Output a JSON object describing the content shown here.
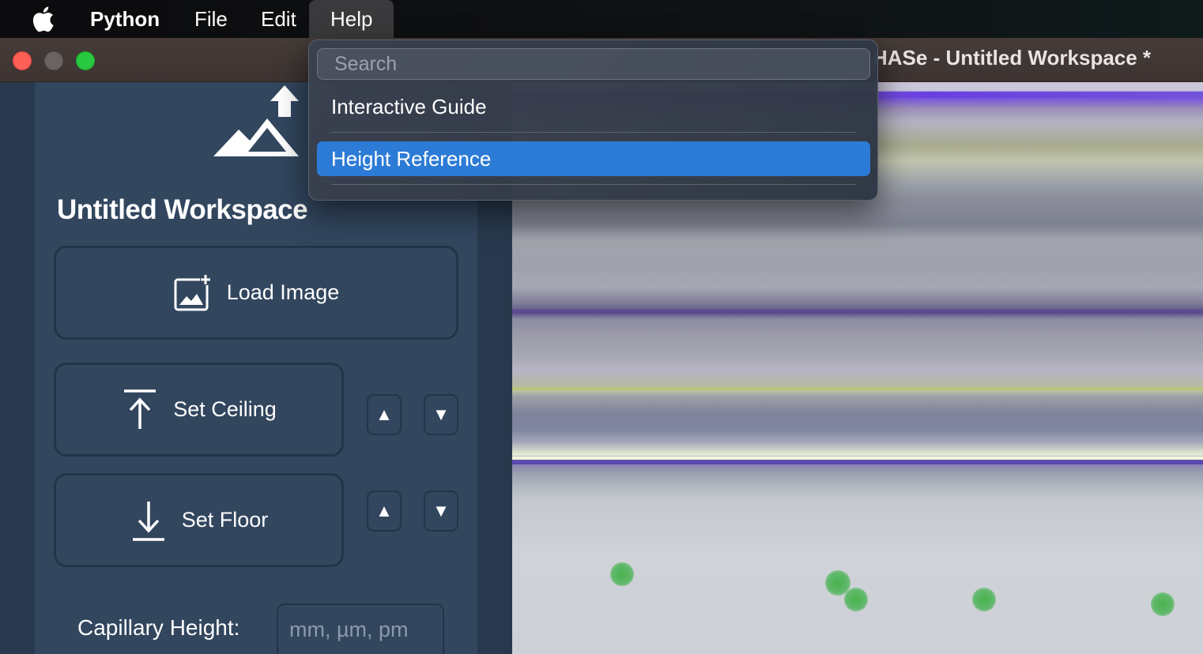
{
  "menubar": {
    "app_name": "Python",
    "items": [
      "File",
      "Edit",
      "Help"
    ],
    "active_item": "Help"
  },
  "window": {
    "title": "HASe - Untitled Workspace *"
  },
  "help_menu": {
    "search_placeholder": "Search",
    "items": [
      {
        "label": "Interactive Guide",
        "highlighted": false
      },
      {
        "label": "Height Reference",
        "highlighted": true
      }
    ],
    "highlight_color": "#2c7bd6"
  },
  "sidebar": {
    "logo_icon": "mountain-up-arrow-icon",
    "workspace_title": "Untitled Workspace",
    "load_image": {
      "label": "Load Image",
      "icon": "image-add-icon"
    },
    "set_ceiling": {
      "label": "Set Ceiling",
      "icon": "arrow-up-to-line-icon",
      "up": "▲",
      "down": "▼"
    },
    "set_floor": {
      "label": "Set Floor",
      "icon": "arrow-down-to-line-icon",
      "up": "▲",
      "down": "▼"
    },
    "capillary_height": {
      "label": "Capillary Height:",
      "placeholder": "mm, µm, pm",
      "value": ""
    }
  },
  "colors": {
    "sidebar_bg": "#32465e",
    "outer_bg": "#29394d",
    "button_border": "#23344a",
    "close": "#fe5f57",
    "minimize": "#6b6361",
    "maximize": "#28c840"
  }
}
